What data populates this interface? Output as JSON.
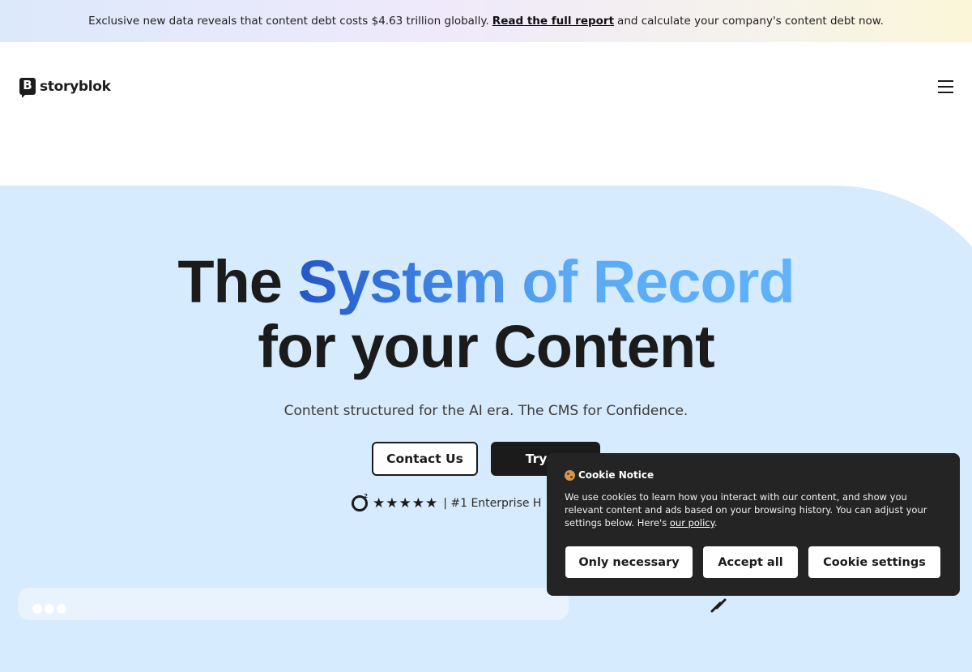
{
  "announcement": {
    "text_before": "Exclusive new data reveals that content debt costs $4.63 trillion globally.",
    "link": "Read the full report",
    "text_after": "and calculate your company's content debt now."
  },
  "nav": {
    "logo_mark": "B",
    "logo_text": "storyblok",
    "menu_icon": "hamburger-menu-icon"
  },
  "hero": {
    "title_part1": "The",
    "title_highlight": "System of Record",
    "title_line2": "for your Content",
    "subtitle": "Content structured for the AI era. The CMS for Confidence.",
    "contact_button": "Contact Us",
    "try_button": "Try fo",
    "rating_icon": "g2-icon",
    "stars": "★★★★★",
    "star_count": 5,
    "rating_text": "| #1 Enterprise H"
  },
  "cookie_notice": {
    "icon": "cookie-icon",
    "title": "Cookie Notice",
    "text": "We use cookies to learn how you interact with our content, and show you relevant content and ads based on your browsing history. You can adjust your settings below. Here's",
    "policy_link": "our policy",
    "text_end": ".",
    "buttons": {
      "necessary": "Only necessary",
      "accept": "Accept all",
      "settings": "Cookie settings"
    }
  },
  "colors": {
    "hero_bg": "#d6ebfd",
    "dark": "#1b1b1b",
    "cookie_bg": "#242424",
    "highlight_start": "#2456c8",
    "highlight_end": "#5fb2fb"
  }
}
